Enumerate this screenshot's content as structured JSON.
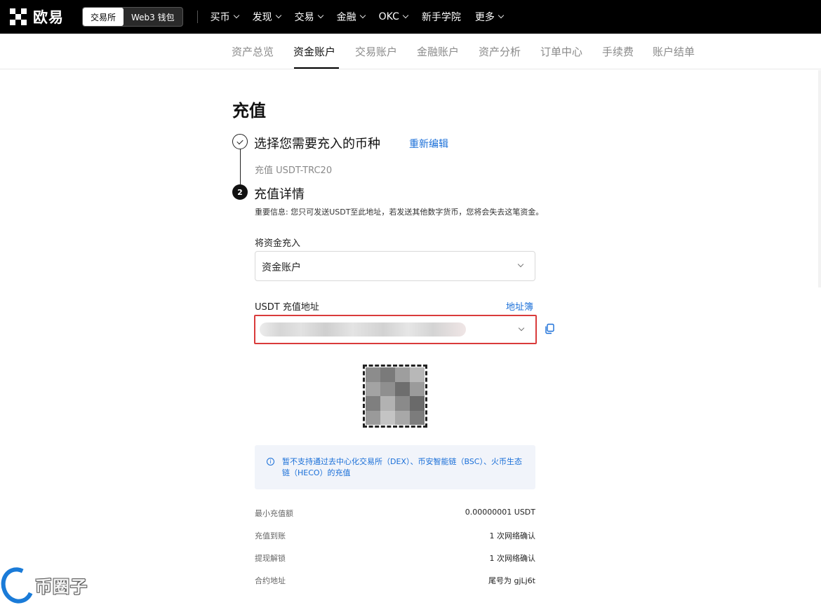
{
  "brand": {
    "name": "欧易"
  },
  "mode_switch": {
    "exchange": "交易所",
    "wallet": "Web3 钱包"
  },
  "top_nav": [
    {
      "label": "买币",
      "dropdown": true
    },
    {
      "label": "发现",
      "dropdown": true
    },
    {
      "label": "交易",
      "dropdown": true
    },
    {
      "label": "金融",
      "dropdown": true
    },
    {
      "label": "OKC",
      "dropdown": true
    },
    {
      "label": "新手学院",
      "dropdown": false
    },
    {
      "label": "更多",
      "dropdown": true
    }
  ],
  "sub_nav": [
    {
      "label": "资产总览"
    },
    {
      "label": "资金账户",
      "active": true
    },
    {
      "label": "交易账户"
    },
    {
      "label": "金融账户"
    },
    {
      "label": "资产分析"
    },
    {
      "label": "订单中心"
    },
    {
      "label": "手续费"
    },
    {
      "label": "账户结单"
    }
  ],
  "page": {
    "title": "充值"
  },
  "step1": {
    "title": "选择您需要充入的币种",
    "edit_link": "重新编辑",
    "summary": "充值 USDT-TRC20"
  },
  "step2": {
    "number": "2",
    "title": "充值详情",
    "important": "重要信息: 您只可发送USDT至此地址，若发送其他数字货币，您将会失去这笔资金。",
    "account_label": "将资金充入",
    "account_value": "资金账户",
    "address_label": "USDT 充值地址",
    "address_book_link": "地址簿"
  },
  "notice": {
    "text": "暂不支持通过去中心化交易所（DEX）、币安智能链（BSC）、火币生态链（HECO）的充值"
  },
  "details": [
    {
      "label": "最小充值额",
      "value": "0.00000001 USDT"
    },
    {
      "label": "充值到账",
      "value": "1 次网络确认"
    },
    {
      "label": "提现解锁",
      "value": "1 次网络确认"
    },
    {
      "label": "合约地址",
      "value": "尾号为 gjLj6t"
    }
  ],
  "watermark": {
    "text": "币圈子"
  },
  "colors": {
    "link": "#1a6fd8",
    "highlight_border": "#d93b3b",
    "notice_bg": "#f1f4fa"
  }
}
